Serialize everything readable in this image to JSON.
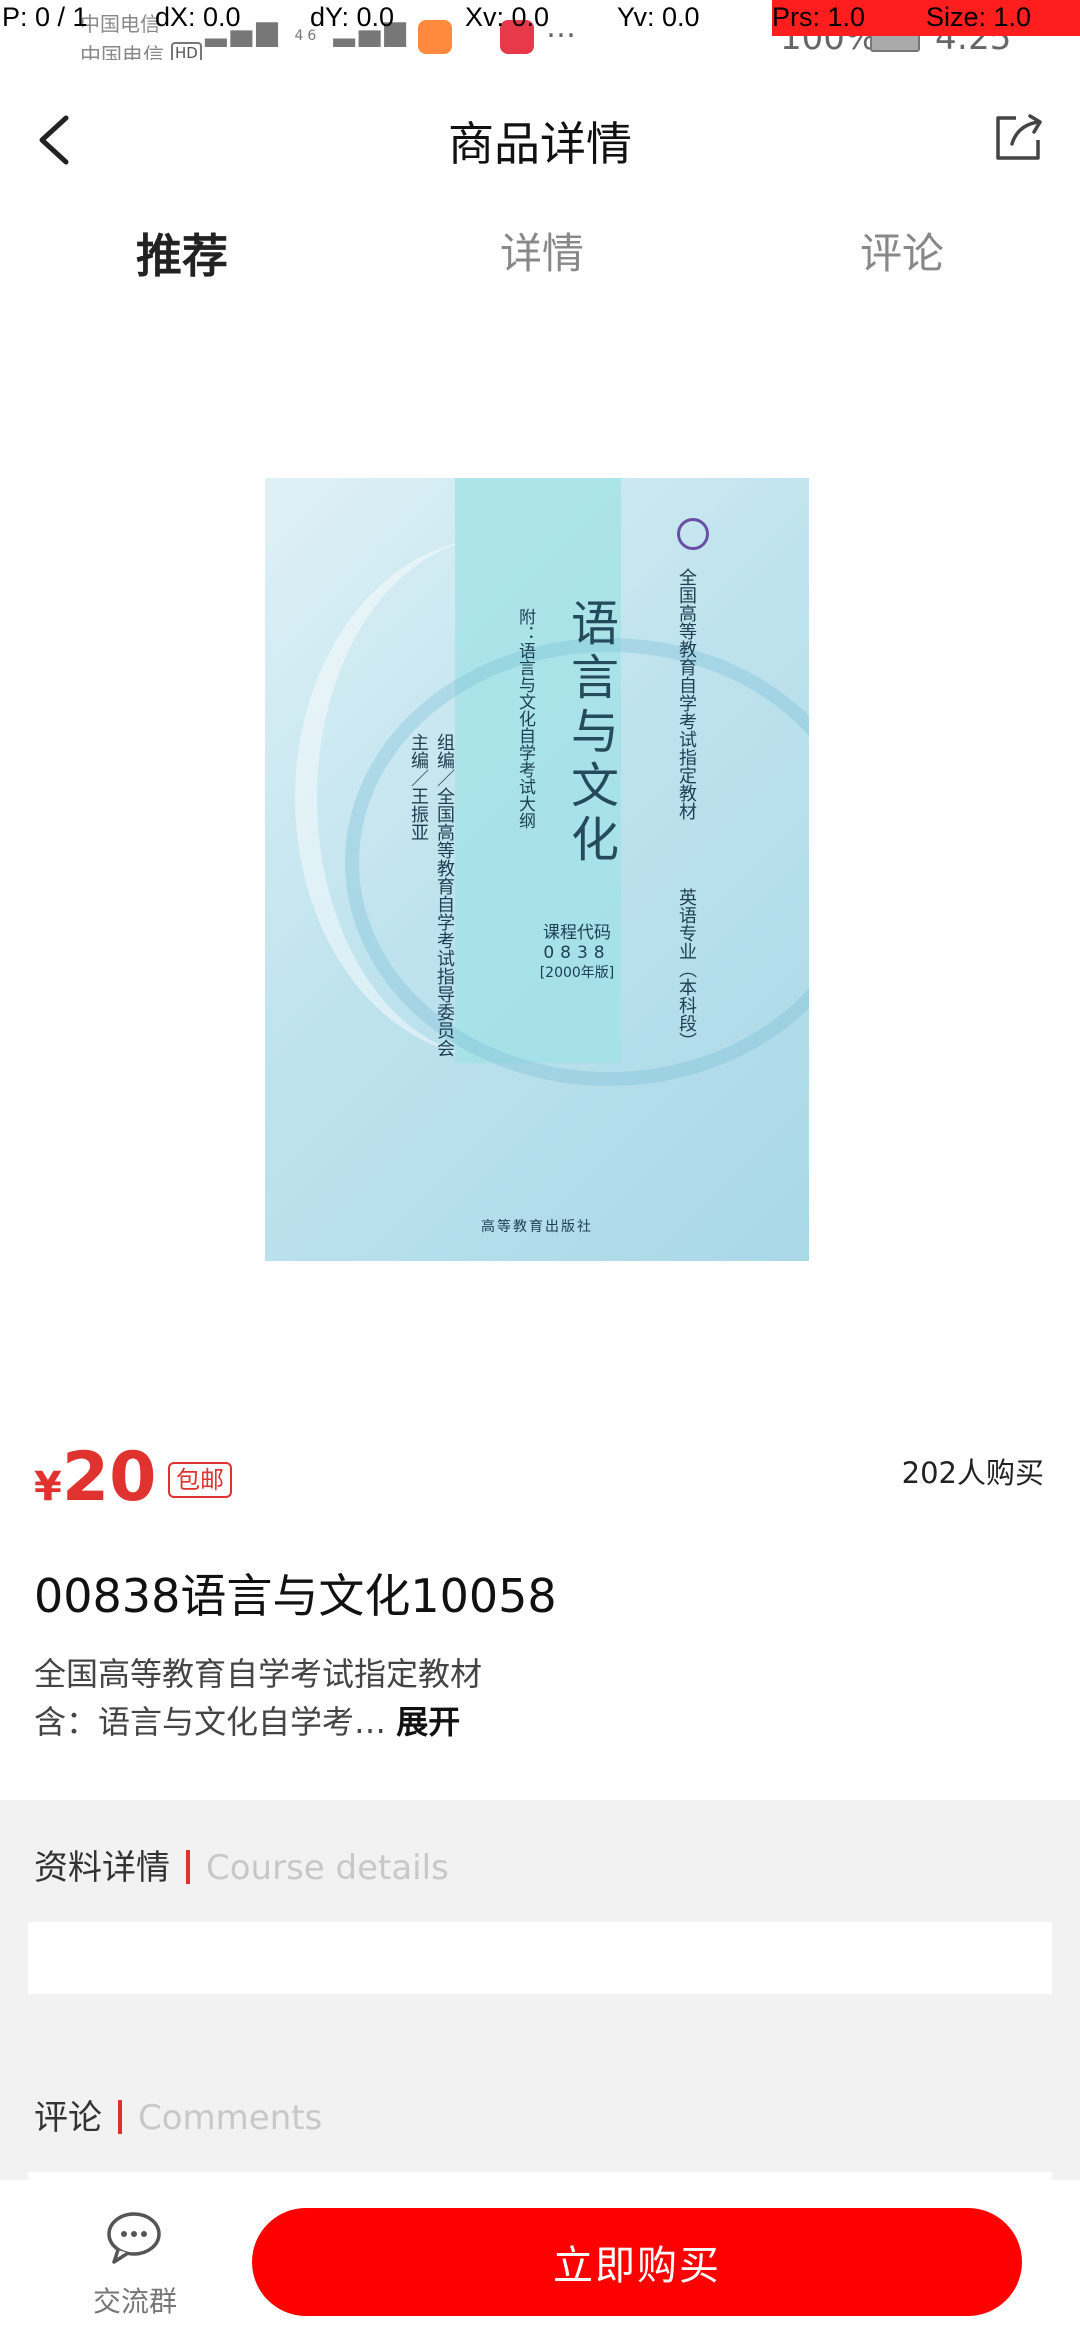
{
  "status_bar": {
    "carrier1": "中国电信",
    "carrier2": "中国电信",
    "hd": "HD",
    "network": "46",
    "battery": "100%",
    "time": "4:25"
  },
  "debug_overlay": {
    "p": "P: 0 / 1",
    "dx": "dX: 0.0",
    "dy": "dY: 0.0",
    "xv": "Xv: 0.0",
    "yv": "Yv: 0.0",
    "prs": "Prs: 1.0",
    "size": "Size: 1.0"
  },
  "header": {
    "title": "商品详情"
  },
  "tabs": [
    {
      "label": "推荐",
      "active": true
    },
    {
      "label": "详情",
      "active": false
    },
    {
      "label": "评论",
      "active": false
    }
  ],
  "cover": {
    "title": "语言与文化",
    "appendix": "附：语言与文化自学考试大纲",
    "series": "全国高等教育自学考试指定教材",
    "series2": "英语专业（本科段）",
    "editor": "主编／王振亚",
    "org": "组编／全国高等教育自学考试指导委员会",
    "code_label": "课程代码",
    "code": "0838",
    "edition": "[2000年版]",
    "publisher": "高等教育出版社"
  },
  "product": {
    "currency": "¥",
    "price": "20",
    "badge": "包邮",
    "buyers": "202人购买",
    "title": "00838语言与文化10058",
    "desc_line1": "全国高等教育自学考试指定教材",
    "desc_line2": "含：语言与文化自学考…",
    "expand": "展开"
  },
  "sections": {
    "details_title": "资料详情",
    "details_en": "Course details",
    "comments_title": "评论",
    "comments_en": "Comments"
  },
  "bottom": {
    "chat_label": "交流群",
    "buy_label": "立即购买"
  },
  "colors": {
    "accent": "#e0322e",
    "buy_button": "#fe0000"
  }
}
